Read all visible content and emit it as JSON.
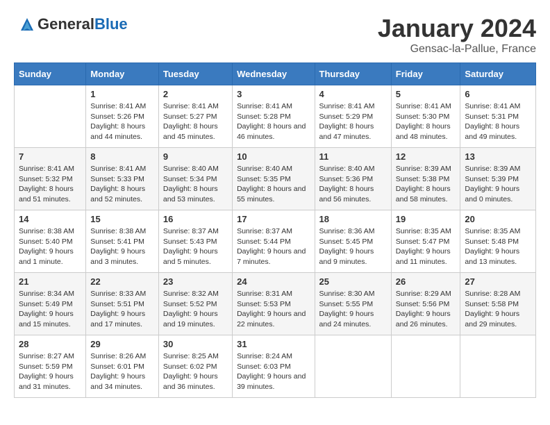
{
  "logo": {
    "text_general": "General",
    "text_blue": "Blue"
  },
  "title": "January 2024",
  "location": "Gensac-la-Pallue, France",
  "days_of_week": [
    "Sunday",
    "Monday",
    "Tuesday",
    "Wednesday",
    "Thursday",
    "Friday",
    "Saturday"
  ],
  "weeks": [
    [
      {
        "day": "",
        "sunrise": "",
        "sunset": "",
        "daylight": ""
      },
      {
        "day": "1",
        "sunrise": "Sunrise: 8:41 AM",
        "sunset": "Sunset: 5:26 PM",
        "daylight": "Daylight: 8 hours and 44 minutes."
      },
      {
        "day": "2",
        "sunrise": "Sunrise: 8:41 AM",
        "sunset": "Sunset: 5:27 PM",
        "daylight": "Daylight: 8 hours and 45 minutes."
      },
      {
        "day": "3",
        "sunrise": "Sunrise: 8:41 AM",
        "sunset": "Sunset: 5:28 PM",
        "daylight": "Daylight: 8 hours and 46 minutes."
      },
      {
        "day": "4",
        "sunrise": "Sunrise: 8:41 AM",
        "sunset": "Sunset: 5:29 PM",
        "daylight": "Daylight: 8 hours and 47 minutes."
      },
      {
        "day": "5",
        "sunrise": "Sunrise: 8:41 AM",
        "sunset": "Sunset: 5:30 PM",
        "daylight": "Daylight: 8 hours and 48 minutes."
      },
      {
        "day": "6",
        "sunrise": "Sunrise: 8:41 AM",
        "sunset": "Sunset: 5:31 PM",
        "daylight": "Daylight: 8 hours and 49 minutes."
      }
    ],
    [
      {
        "day": "7",
        "sunrise": "Sunrise: 8:41 AM",
        "sunset": "Sunset: 5:32 PM",
        "daylight": "Daylight: 8 hours and 51 minutes."
      },
      {
        "day": "8",
        "sunrise": "Sunrise: 8:41 AM",
        "sunset": "Sunset: 5:33 PM",
        "daylight": "Daylight: 8 hours and 52 minutes."
      },
      {
        "day": "9",
        "sunrise": "Sunrise: 8:40 AM",
        "sunset": "Sunset: 5:34 PM",
        "daylight": "Daylight: 8 hours and 53 minutes."
      },
      {
        "day": "10",
        "sunrise": "Sunrise: 8:40 AM",
        "sunset": "Sunset: 5:35 PM",
        "daylight": "Daylight: 8 hours and 55 minutes."
      },
      {
        "day": "11",
        "sunrise": "Sunrise: 8:40 AM",
        "sunset": "Sunset: 5:36 PM",
        "daylight": "Daylight: 8 hours and 56 minutes."
      },
      {
        "day": "12",
        "sunrise": "Sunrise: 8:39 AM",
        "sunset": "Sunset: 5:38 PM",
        "daylight": "Daylight: 8 hours and 58 minutes."
      },
      {
        "day": "13",
        "sunrise": "Sunrise: 8:39 AM",
        "sunset": "Sunset: 5:39 PM",
        "daylight": "Daylight: 9 hours and 0 minutes."
      }
    ],
    [
      {
        "day": "14",
        "sunrise": "Sunrise: 8:38 AM",
        "sunset": "Sunset: 5:40 PM",
        "daylight": "Daylight: 9 hours and 1 minute."
      },
      {
        "day": "15",
        "sunrise": "Sunrise: 8:38 AM",
        "sunset": "Sunset: 5:41 PM",
        "daylight": "Daylight: 9 hours and 3 minutes."
      },
      {
        "day": "16",
        "sunrise": "Sunrise: 8:37 AM",
        "sunset": "Sunset: 5:43 PM",
        "daylight": "Daylight: 9 hours and 5 minutes."
      },
      {
        "day": "17",
        "sunrise": "Sunrise: 8:37 AM",
        "sunset": "Sunset: 5:44 PM",
        "daylight": "Daylight: 9 hours and 7 minutes."
      },
      {
        "day": "18",
        "sunrise": "Sunrise: 8:36 AM",
        "sunset": "Sunset: 5:45 PM",
        "daylight": "Daylight: 9 hours and 9 minutes."
      },
      {
        "day": "19",
        "sunrise": "Sunrise: 8:35 AM",
        "sunset": "Sunset: 5:47 PM",
        "daylight": "Daylight: 9 hours and 11 minutes."
      },
      {
        "day": "20",
        "sunrise": "Sunrise: 8:35 AM",
        "sunset": "Sunset: 5:48 PM",
        "daylight": "Daylight: 9 hours and 13 minutes."
      }
    ],
    [
      {
        "day": "21",
        "sunrise": "Sunrise: 8:34 AM",
        "sunset": "Sunset: 5:49 PM",
        "daylight": "Daylight: 9 hours and 15 minutes."
      },
      {
        "day": "22",
        "sunrise": "Sunrise: 8:33 AM",
        "sunset": "Sunset: 5:51 PM",
        "daylight": "Daylight: 9 hours and 17 minutes."
      },
      {
        "day": "23",
        "sunrise": "Sunrise: 8:32 AM",
        "sunset": "Sunset: 5:52 PM",
        "daylight": "Daylight: 9 hours and 19 minutes."
      },
      {
        "day": "24",
        "sunrise": "Sunrise: 8:31 AM",
        "sunset": "Sunset: 5:53 PM",
        "daylight": "Daylight: 9 hours and 22 minutes."
      },
      {
        "day": "25",
        "sunrise": "Sunrise: 8:30 AM",
        "sunset": "Sunset: 5:55 PM",
        "daylight": "Daylight: 9 hours and 24 minutes."
      },
      {
        "day": "26",
        "sunrise": "Sunrise: 8:29 AM",
        "sunset": "Sunset: 5:56 PM",
        "daylight": "Daylight: 9 hours and 26 minutes."
      },
      {
        "day": "27",
        "sunrise": "Sunrise: 8:28 AM",
        "sunset": "Sunset: 5:58 PM",
        "daylight": "Daylight: 9 hours and 29 minutes."
      }
    ],
    [
      {
        "day": "28",
        "sunrise": "Sunrise: 8:27 AM",
        "sunset": "Sunset: 5:59 PM",
        "daylight": "Daylight: 9 hours and 31 minutes."
      },
      {
        "day": "29",
        "sunrise": "Sunrise: 8:26 AM",
        "sunset": "Sunset: 6:01 PM",
        "daylight": "Daylight: 9 hours and 34 minutes."
      },
      {
        "day": "30",
        "sunrise": "Sunrise: 8:25 AM",
        "sunset": "Sunset: 6:02 PM",
        "daylight": "Daylight: 9 hours and 36 minutes."
      },
      {
        "day": "31",
        "sunrise": "Sunrise: 8:24 AM",
        "sunset": "Sunset: 6:03 PM",
        "daylight": "Daylight: 9 hours and 39 minutes."
      },
      {
        "day": "",
        "sunrise": "",
        "sunset": "",
        "daylight": ""
      },
      {
        "day": "",
        "sunrise": "",
        "sunset": "",
        "daylight": ""
      },
      {
        "day": "",
        "sunrise": "",
        "sunset": "",
        "daylight": ""
      }
    ]
  ]
}
